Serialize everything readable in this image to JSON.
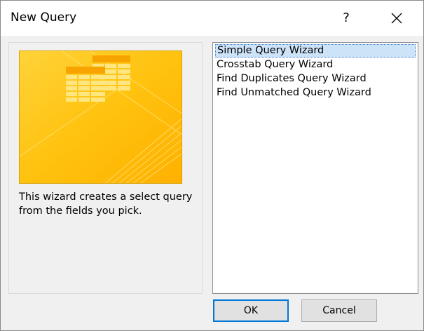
{
  "window": {
    "title": "New Query",
    "help_label": "?"
  },
  "left_panel": {
    "description": "This wizard creates a select query from the fields you pick."
  },
  "wizard_list": {
    "items": [
      "Simple Query Wizard",
      "Crosstab Query Wizard",
      "Find Duplicates Query Wizard",
      "Find Unmatched Query Wizard"
    ],
    "selected": "Simple Query Wizard"
  },
  "buttons": {
    "ok_label": "OK",
    "cancel_label": "Cancel"
  },
  "colors": {
    "accent": "#0078d7",
    "selection": "#cde3f7",
    "image_primary": "#ffc20e",
    "image_highlight": "#f7a400"
  }
}
